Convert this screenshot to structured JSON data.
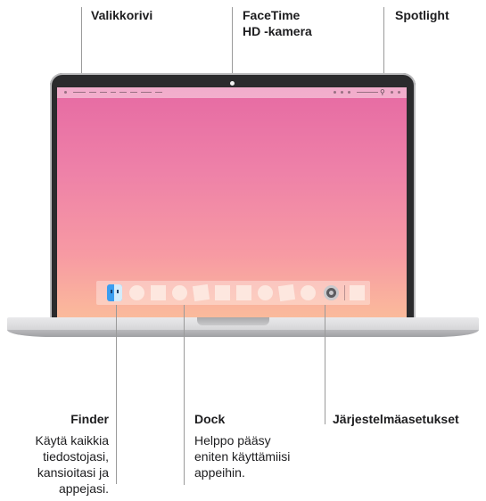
{
  "callouts": {
    "menubar": {
      "title": "Valikkorivi"
    },
    "camera": {
      "title_line1": "FaceTime",
      "title_line2": "HD -kamera"
    },
    "spotlight": {
      "title": "Spotlight"
    },
    "finder": {
      "title": "Finder",
      "desc_lines": [
        "Käytä kaikkia",
        "tiedostojasi,",
        "kansioitasi ja",
        "appejasi."
      ]
    },
    "dock": {
      "title": "Dock",
      "desc_lines": [
        "Helppo pääsy",
        "eniten käyttämiisi",
        "appeihin."
      ]
    },
    "settings": {
      "title": "Järjestelmäasetukset"
    }
  },
  "icons": {
    "finder": "finder-icon",
    "system_settings": "gear-icon",
    "spotlight": "search-icon"
  },
  "colors": {
    "screen_top": "#e66aa3",
    "screen_bottom": "#fbbf9a",
    "leader_line": "#9a9a9a"
  }
}
